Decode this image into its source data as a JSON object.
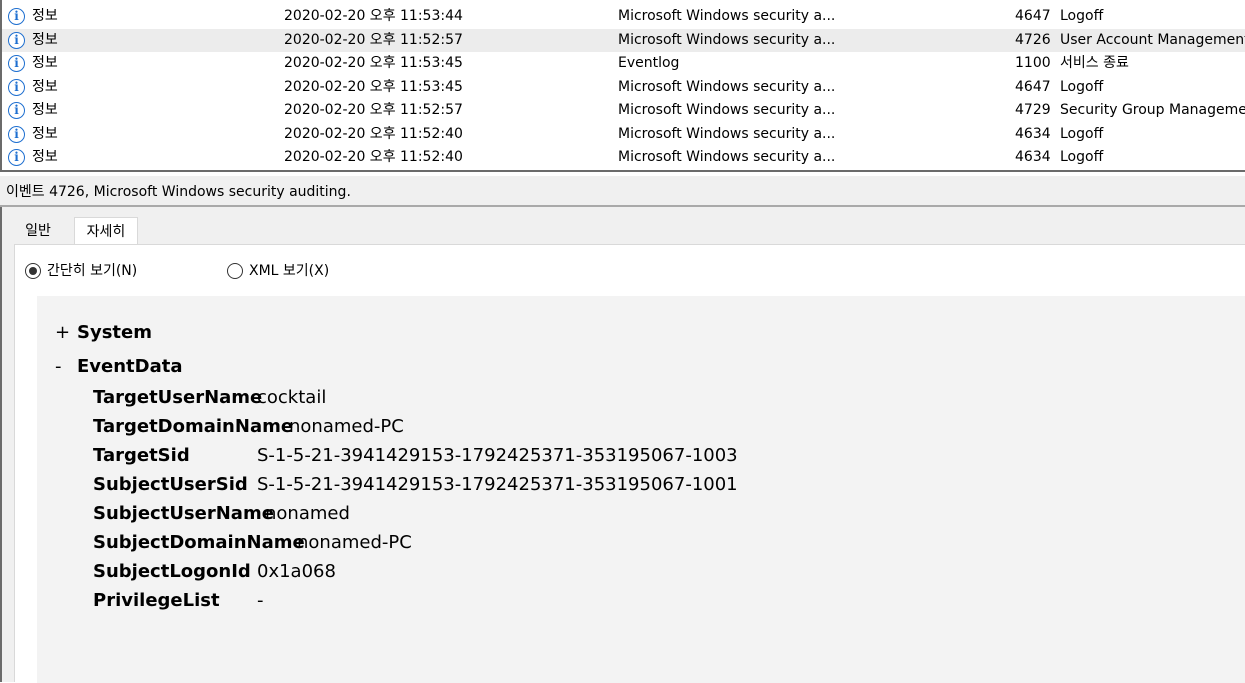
{
  "event_list": {
    "rows": [
      {
        "level": "정보",
        "date": "2020-02-20 오후 11:53:44",
        "source": "Microsoft Windows security a...",
        "event_id": "4647",
        "task": "Logoff",
        "selected": false
      },
      {
        "level": "정보",
        "date": "2020-02-20 오후 11:52:57",
        "source": "Microsoft Windows security a...",
        "event_id": "4726",
        "task": "User Account Management",
        "selected": true
      },
      {
        "level": "정보",
        "date": "2020-02-20 오후 11:53:45",
        "source": "Eventlog",
        "event_id": "1100",
        "task": "서비스 종료",
        "selected": false
      },
      {
        "level": "정보",
        "date": "2020-02-20 오후 11:53:45",
        "source": "Microsoft Windows security a...",
        "event_id": "4647",
        "task": "Logoff",
        "selected": false
      },
      {
        "level": "정보",
        "date": "2020-02-20 오후 11:52:57",
        "source": "Microsoft Windows security a...",
        "event_id": "4729",
        "task": "Security Group Management",
        "selected": false
      },
      {
        "level": "정보",
        "date": "2020-02-20 오후 11:52:40",
        "source": "Microsoft Windows security a...",
        "event_id": "4634",
        "task": "Logoff",
        "selected": false
      },
      {
        "level": "정보",
        "date": "2020-02-20 오후 11:52:40",
        "source": "Microsoft Windows security a...",
        "event_id": "4634",
        "task": "Logoff",
        "selected": false
      }
    ],
    "icon": "info-icon",
    "icon_color": "#1e6fd0"
  },
  "details": {
    "header": "이벤트 4726, Microsoft Windows security auditing.",
    "tabs": {
      "general": "일반",
      "details": "자세히"
    },
    "view_options": {
      "friendly": "간단히 보기(N)",
      "xml": "XML 보기(X)",
      "selected": "friendly"
    },
    "tree": {
      "system": {
        "symbol": "+",
        "name": "System"
      },
      "eventdata": {
        "symbol": "-",
        "name": "EventData"
      },
      "fields": [
        {
          "key": "TargetUserName",
          "value": "cocktail"
        },
        {
          "key": "TargetDomainName",
          "value": "nonamed-PC"
        },
        {
          "key": "TargetSid",
          "value": "S-1-5-21-3941429153-1792425371-353195067-1003"
        },
        {
          "key": "SubjectUserSid",
          "value": "S-1-5-21-3941429153-1792425371-353195067-1001"
        },
        {
          "key": "SubjectUserName",
          "value": "nonamed"
        },
        {
          "key": "SubjectDomainName",
          "value": "nonamed-PC"
        },
        {
          "key": "SubjectLogonId",
          "value": "0x1a068"
        },
        {
          "key": "PrivilegeList",
          "value": "-"
        }
      ]
    }
  }
}
